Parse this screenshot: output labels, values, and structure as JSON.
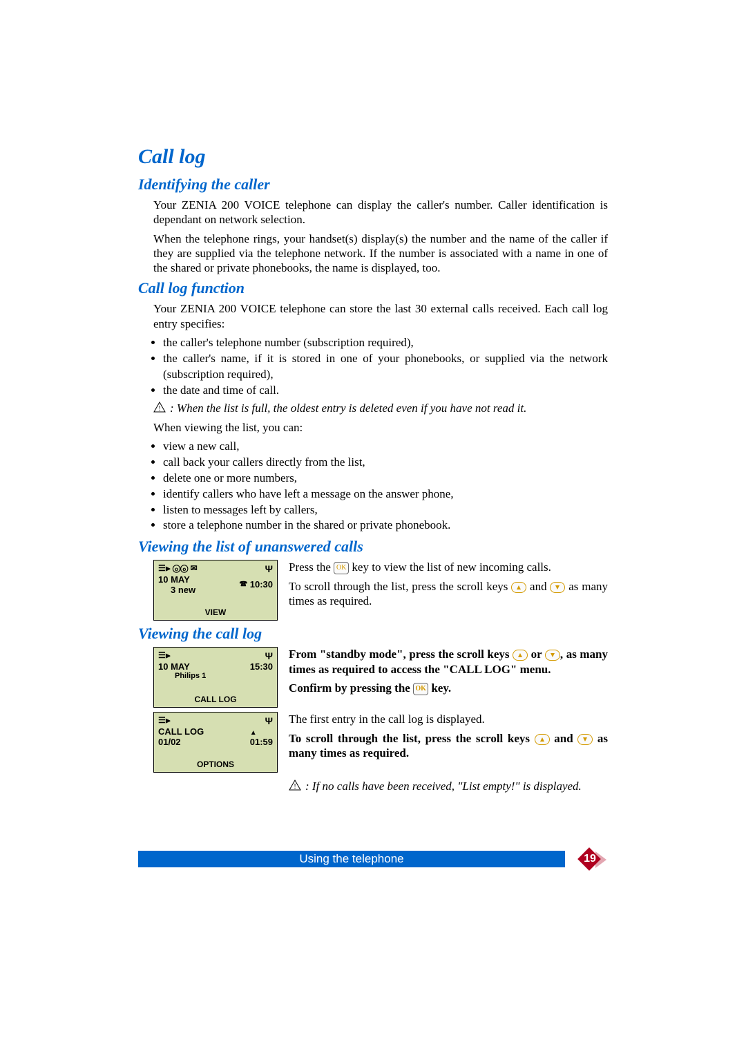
{
  "headings": {
    "h1": "Call log",
    "h2a": "Identifying the caller",
    "h2b": "Call log function",
    "h2c": "Viewing the list of unanswered calls",
    "h2d": "Viewing the call log"
  },
  "identifying": {
    "p1": "Your ZENIA 200 VOICE telephone can display the caller's number. Caller identification is dependant on network selection.",
    "p2": "When the telephone rings, your handset(s) display(s) the number and the name of the caller if they are supplied via the telephone network. If the number is associated with a name in one of the shared or private phonebooks, the name is displayed, too."
  },
  "function": {
    "intro": "Your ZENIA 200 VOICE telephone can store the last 30 external calls received. Each call log entry specifies:",
    "specifies": [
      "the caller's telephone number (subscription required),",
      "the caller's name, if it is stored in one of your phonebooks, or supplied via the network (subscription required),",
      "the date and time of call."
    ],
    "warn_full": ":  When the list is full, the oldest entry is deleted even if you have not read it.",
    "when_viewing": "When viewing the list, you can:",
    "actions": [
      "view a new call,",
      "call back your callers directly from the list,",
      "delete one or more numbers,",
      "identify callers who have left a message on the answer phone,",
      "listen to messages left by callers,",
      "store a telephone number in the shared or private phonebook."
    ]
  },
  "unanswered": {
    "lcd": {
      "date": "10 MAY",
      "new": "3 new",
      "time": "10:30",
      "softkey": "VIEW"
    },
    "text1a": "Press the ",
    "text1b": " key to view the list of new incoming calls.",
    "text2a": "To scroll through the list, press the scroll keys ",
    "text2b": " and ",
    "text2c": " as many times as required."
  },
  "viewlog": {
    "lcd1": {
      "date": "10 MAY",
      "time": "15:30",
      "name": "Philips 1",
      "softkey": "CALL LOG"
    },
    "block1_a": "From \"standby mode\", press the scroll keys ",
    "block1_b": " or ",
    "block1_c": ", as many times as required to access the \"CALL LOG\" menu.",
    "confirm_a": "Confirm by pressing the ",
    "confirm_b": " key.",
    "lcd2": {
      "line1": "CALL LOG",
      "line2": "01/02",
      "time": "01:59",
      "softkey": "OPTIONS"
    },
    "first_entry": "The first entry in the call log is displayed.",
    "scroll_a": "To scroll through the list, press the scroll keys ",
    "scroll_b": " and ",
    "scroll_c": " as many times as required.",
    "empty_warn": ": If no calls have been received, \"List empty!\" is displayed."
  },
  "footer": {
    "label": "Using the telephone",
    "page": "19"
  },
  "icons": {
    "ok": "OK",
    "up": "▲",
    "down": "▼",
    "antenna": "Ψ",
    "envelope": "✉",
    "tape": "ⓞⓞ",
    "callerid": "☰⫸"
  }
}
